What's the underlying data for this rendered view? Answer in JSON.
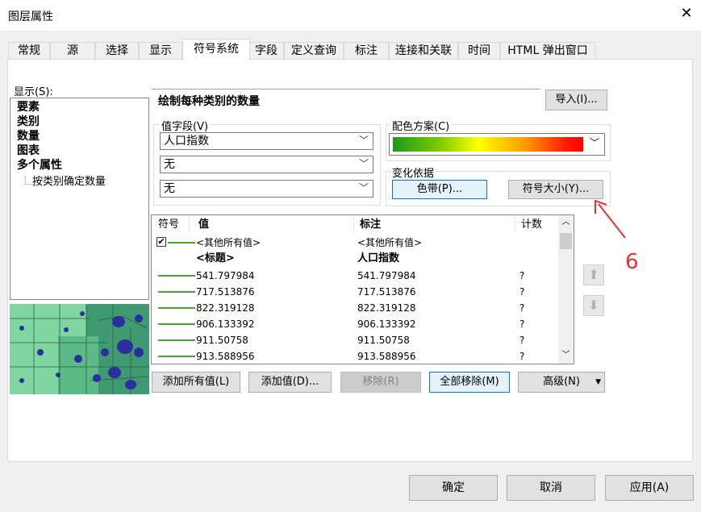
{
  "window": {
    "title": "图层属性"
  },
  "tabs": [
    "常规",
    "源",
    "选择",
    "显示",
    "符号系统",
    "字段",
    "定义查询",
    "标注",
    "连接和关联",
    "时间",
    "HTML 弹出窗口"
  ],
  "left": {
    "show_label": "显示(S):",
    "tree": [
      "要素",
      "类别",
      "数量",
      "图表",
      "多个属性"
    ],
    "tree_sub": "按类别确定数量"
  },
  "main": {
    "headline": "绘制每种类别的数量",
    "import_button": "导入(I)...",
    "value_fields_label": "值字段(V)",
    "value_fields": [
      "人口指数",
      "无",
      "无"
    ],
    "color_scheme_label": "配色方案(C)",
    "variation_label": "变化依据",
    "color_ramp_button": "色带(P)...",
    "symbol_size_button": "符号大小(Y)...",
    "columns": {
      "symbol": "符号",
      "value": "值",
      "label": "标注",
      "count": "计数"
    },
    "rows": [
      {
        "value": "<其他所有值>",
        "label": "<其他所有值>",
        "count": ""
      },
      {
        "value": "<标题>",
        "label": "人口指数",
        "count": ""
      },
      {
        "value": "541.797984",
        "label": "541.797984",
        "count": "?"
      },
      {
        "value": "717.513876",
        "label": "717.513876",
        "count": "?"
      },
      {
        "value": "822.319128",
        "label": "822.319128",
        "count": "?"
      },
      {
        "value": "906.133392",
        "label": "906.133392",
        "count": "?"
      },
      {
        "value": "911.50758",
        "label": "911.50758",
        "count": "?"
      },
      {
        "value": "913.588956",
        "label": "913.588956",
        "count": "?"
      }
    ],
    "buttons": {
      "add_all": "添加所有值(L)",
      "add_values": "添加值(D)...",
      "remove": "移除(R)",
      "remove_all": "全部移除(M)",
      "advanced": "高级(N)"
    }
  },
  "footer": {
    "ok": "确定",
    "cancel": "取消",
    "apply": "应用(A)"
  },
  "annotation": "6",
  "colors": {
    "symbol_line": "#4aa02c",
    "annotation": "#e8302c",
    "focus": "#0078d7"
  }
}
